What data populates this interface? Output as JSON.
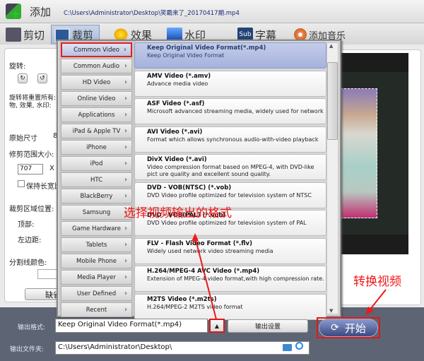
{
  "toolbar": {
    "add_label": "添加",
    "file_path": "C:\\Users\\Administrator\\Desktop\\笑霸来了_20170417期.mp4"
  },
  "tabs": [
    {
      "label": "剪切"
    },
    {
      "label": "裁剪",
      "active": true
    },
    {
      "label": "效果"
    },
    {
      "label": "水印"
    },
    {
      "label": "字幕"
    },
    {
      "label": "添加音乐"
    }
  ],
  "left_panel": {
    "rotate_label": "旋转:",
    "rotate_note_1": "旋转将重置所有:",
    "rotate_note_2": "物, 效果, 水印:",
    "original_size_label": "原始尺寸",
    "original_size_value": "8",
    "crop_size_label": "修剪范围大小:",
    "crop_width": "707",
    "x_label": "X",
    "keep_ratio_label": "保持长宽比",
    "crop_pos_label": "裁剪区域位置:",
    "top_label": "顶部:",
    "left_label": "左边距:",
    "divider_color_label": "分割线颜色:",
    "default_button": "缺省"
  },
  "categories": [
    "Common Video",
    "Common Audio",
    "HD Video",
    "Online Video",
    "Applications",
    "iPad & Apple TV",
    "iPhone",
    "iPod",
    "HTC",
    "BlackBerry",
    "Samsung",
    "Game Hardware",
    "Tablets",
    "Mobile Phone",
    "Media Player",
    "User Defined",
    "Recent"
  ],
  "selected_category": "Common Video",
  "formats": [
    {
      "title": "Keep Original Video Format(*.mp4)",
      "desc": "Keep Original Video Format"
    },
    {
      "title": "AMV Video (*.amv)",
      "desc": "Advance media video"
    },
    {
      "title": "ASF Video (*.asf)",
      "desc": "Microsoft advanced streaming media, widely used for network"
    },
    {
      "title": "AVI Video (*.avi)",
      "desc": "Format which allows synchronous audio-with-video playback"
    },
    {
      "title": "DivX Video (*.avi)",
      "desc": "Video compression format based on MPEG-4, with DVD-like pict ure quality and excellent sound quality."
    },
    {
      "title": "DVD - VOB(NTSC) (*.vob)",
      "desc": "DVD Video profile optimized for television system of NTSC"
    },
    {
      "title": "DVD - VOB(PAL) (*.vob)",
      "desc": "DVD Video profile optimized for television system of PAL"
    },
    {
      "title": "FLV - Flash Video Format (*.flv)",
      "desc": "Widely used network video streaming media"
    },
    {
      "title": "H.264/MPEG-4 AVC Video (*.mp4)",
      "desc": "Extension of MPEG-4 video format,with high compression rate."
    },
    {
      "title": "M2TS Video (*.m2ts)",
      "desc": "H.264/MPEG-2 M2TS video format"
    }
  ],
  "annotations": {
    "select_format": "选择视频输出的格式",
    "convert": "转换视频"
  },
  "bottom": {
    "output_format_label": "输出格式:",
    "output_format_value": "Keep Original Video Format(*.mp4)",
    "output_settings_button": "输出设置",
    "start_button": "开始",
    "output_folder_label": "输出文件夹:",
    "output_folder_value": "C:\\Users\\Administrator\\Desktop\\"
  },
  "colors": {
    "annotation": "#f01818",
    "bottom_bg": "#5d6575",
    "selected_item": "#b0bce2"
  }
}
